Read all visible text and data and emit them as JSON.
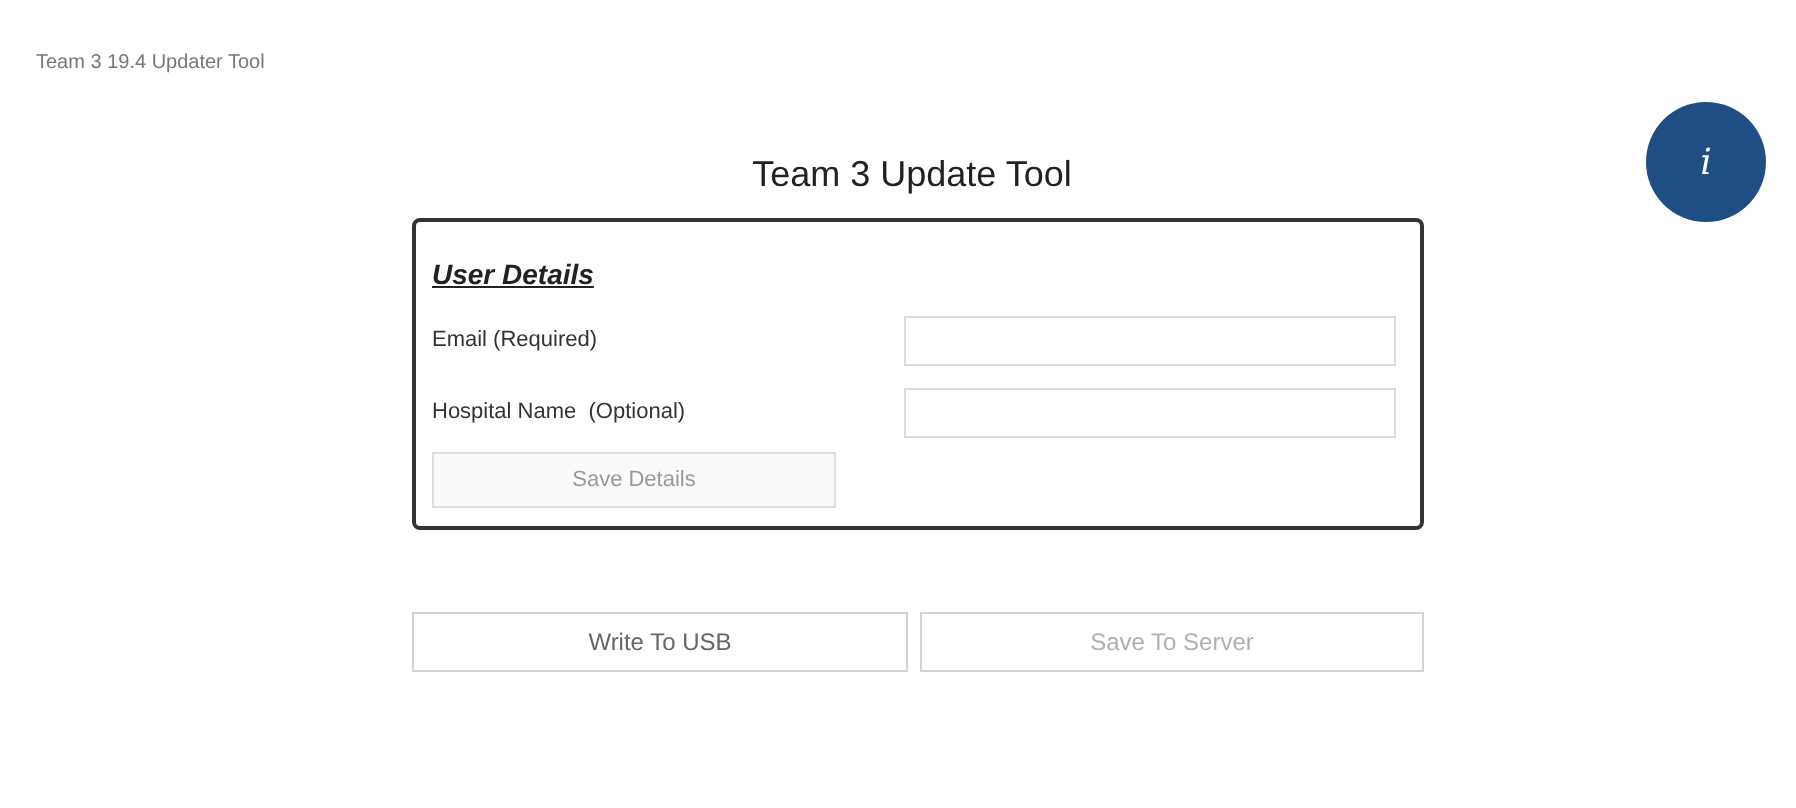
{
  "window": {
    "title": "Team 3 19.4 Updater Tool"
  },
  "heading": "Team 3 Update Tool",
  "info_button": {
    "label": "i"
  },
  "user_details": {
    "title": "User Details",
    "fields": [
      {
        "label": "Email (Required)"
      },
      {
        "label": "Hospital Name  (Optional)"
      }
    ],
    "save_button": {
      "label": "Save Details",
      "disabled": true
    }
  },
  "actions": [
    {
      "label": "Write To USB",
      "disabled": false
    },
    {
      "label": "Save To Server",
      "disabled": true
    }
  ]
}
